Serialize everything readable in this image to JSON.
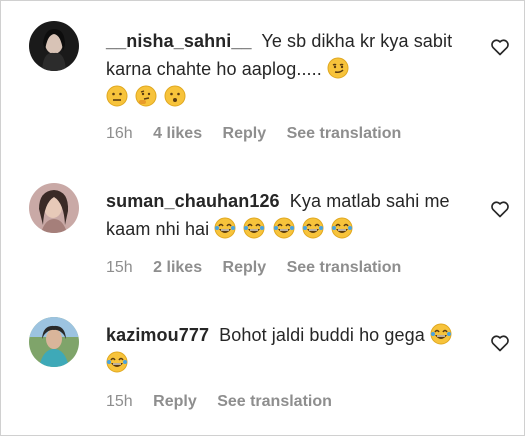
{
  "comments": [
    {
      "username": "__nisha_sahni__",
      "text": "Ye sb dikha kr kya sabit karna chahte ho aaplog.....",
      "emojis": [
        "smirk-face",
        "neutral-face",
        "thinking-face",
        "hushed-face"
      ],
      "time": "16h",
      "likes": "4 likes",
      "reply": "Reply",
      "translate": "See translation"
    },
    {
      "username": "suman_chauhan126",
      "text": "Kya matlab sahi me kaam nhi hai",
      "emojis": [
        "tears-of-joy-face",
        "tears-of-joy-face",
        "tears-of-joy-face",
        "tears-of-joy-face",
        "tears-of-joy-face"
      ],
      "time": "15h",
      "likes": "2 likes",
      "reply": "Reply",
      "translate": "See translation"
    },
    {
      "username": "kazimou777",
      "text": "Bohot jaldi buddi ho gega",
      "emojis": [
        "tears-of-joy-face",
        "tears-of-joy-face"
      ],
      "time": "15h",
      "reply": "Reply",
      "translate": "See translation"
    }
  ],
  "colors": {
    "text": "#262626",
    "muted": "#8e8e8e",
    "emoji_face": "#f7c33b"
  }
}
